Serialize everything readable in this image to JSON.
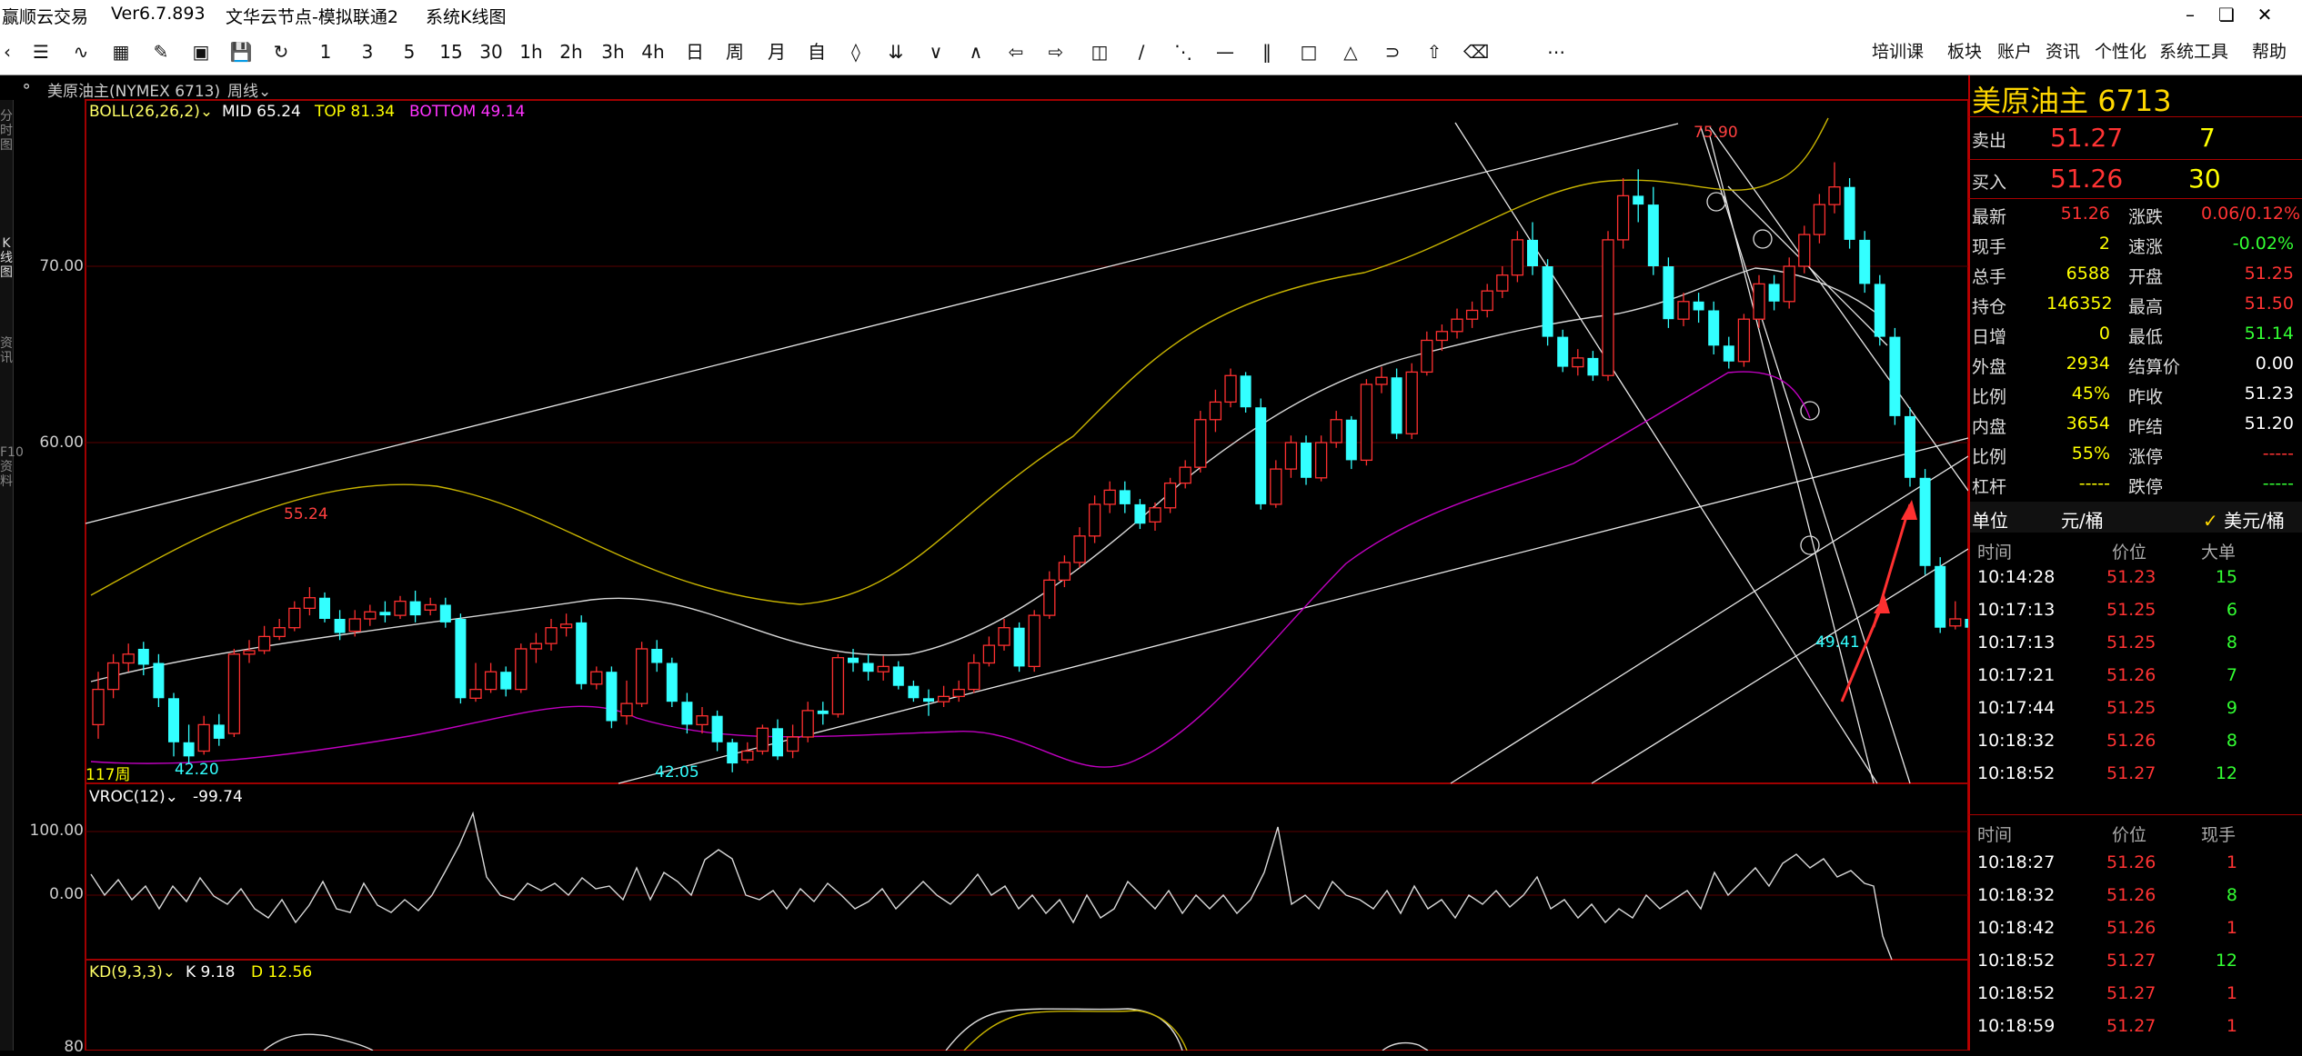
{
  "app": {
    "name": "赢顺云交易",
    "version": "Ver6.7.893",
    "node": "文华云节点-模拟联通2",
    "mode": "系统K线图"
  },
  "toolbar": {
    "periods": [
      "1",
      "3",
      "5",
      "15",
      "30",
      "1h",
      "2h",
      "3h",
      "4h",
      "日",
      "周",
      "月",
      "自"
    ],
    "menus": [
      "培训课",
      "板块",
      "账户",
      "资讯",
      "个性化",
      "系统工具",
      "帮助"
    ]
  },
  "chart_header": {
    "instrument": "美原油主(NYMEX 6713)",
    "period": "周线"
  },
  "main_panel": {
    "indicator": "BOLL(26,26,2)",
    "mid": "MID 65.24",
    "top": "TOP 81.34",
    "bottom": "BOTTOM 49.14",
    "axis_70": "70.00",
    "axis_60": "60.00",
    "ann_high": "75.90",
    "ann_5524": "55.24",
    "ann_4220": "42.20",
    "ann_4205": "42.05",
    "ann_4941": "49.41",
    "count": "117周"
  },
  "vroc_panel": {
    "indicator": "VROC(12)",
    "value": "-99.74",
    "axis_100": "100.00",
    "axis_0": "0.00"
  },
  "kd_panel": {
    "indicator": "KD(9,3,3)",
    "k": "K 9.18",
    "d": "D 12.56",
    "axis_80": "80"
  },
  "left_tabs": [
    "分时图",
    "K线图",
    "资讯",
    "F10资料"
  ],
  "quote": {
    "title": "美原油主",
    "code": "6713",
    "ask_label": "卖出",
    "ask_price": "51.27",
    "ask_vol": "7",
    "bid_label": "买入",
    "bid_price": "51.26",
    "bid_vol": "30",
    "stats": [
      {
        "l1": "最新",
        "v1": "51.26",
        "l2": "涨跌",
        "v2": "0.06/0.12%",
        "c1": "#ff3333",
        "c2": "#ff3333"
      },
      {
        "l1": "现手",
        "v1": "2",
        "l2": "速涨",
        "v2": "-0.02%",
        "c1": "#ffff00",
        "c2": "#33ff33"
      },
      {
        "l1": "总手",
        "v1": "6588",
        "l2": "开盘",
        "v2": "51.25",
        "c1": "#ffff00",
        "c2": "#ff3333"
      },
      {
        "l1": "持仓",
        "v1": "146352",
        "l2": "最高",
        "v2": "51.50",
        "c1": "#ffff00",
        "c2": "#ff3333"
      },
      {
        "l1": "日增",
        "v1": "0",
        "l2": "最低",
        "v2": "51.14",
        "c1": "#ffff00",
        "c2": "#33ff33"
      },
      {
        "l1": "外盘",
        "v1": "2934",
        "l2": "结算价",
        "v2": "0.00",
        "c1": "#ffff00",
        "c2": "#ffffff"
      },
      {
        "l1": "比例",
        "v1": "45%",
        "l2": "昨收",
        "v2": "51.23",
        "c1": "#ffff00",
        "c2": "#ffffff"
      },
      {
        "l1": "内盘",
        "v1": "3654",
        "l2": "昨结",
        "v2": "51.20",
        "c1": "#ffff00",
        "c2": "#ffffff"
      },
      {
        "l1": "比例",
        "v1": "55%",
        "l2": "涨停",
        "v2": "-----",
        "c1": "#ffff00",
        "c2": "#ff3333"
      },
      {
        "l1": "杠杆",
        "v1": "-----",
        "l2": "跌停",
        "v2": "-----",
        "c1": "#ffff00",
        "c2": "#33ff33"
      }
    ],
    "unit_label": "单位",
    "unit_value": "元/桶",
    "unit_check": "美元/桶",
    "big_header": [
      "时间",
      "价位",
      "大单"
    ],
    "big_trades": [
      [
        "10:14:28",
        "51.23",
        "15"
      ],
      [
        "10:17:13",
        "51.25",
        "6"
      ],
      [
        "10:17:13",
        "51.25",
        "8"
      ],
      [
        "10:17:21",
        "51.26",
        "7"
      ],
      [
        "10:17:44",
        "51.25",
        "9"
      ],
      [
        "10:18:32",
        "51.26",
        "8"
      ],
      [
        "10:18:52",
        "51.27",
        "12"
      ]
    ],
    "tick_header": [
      "时间",
      "价位",
      "现手"
    ],
    "ticks": [
      [
        "10:18:27",
        "51.26",
        "1"
      ],
      [
        "10:18:32",
        "51.26",
        "8"
      ],
      [
        "10:18:42",
        "51.26",
        "1"
      ],
      [
        "10:18:52",
        "51.27",
        "12"
      ],
      [
        "10:18:52",
        "51.27",
        "1"
      ],
      [
        "10:18:59",
        "51.27",
        "1"
      ]
    ]
  },
  "chart_data": {
    "type": "candlestick",
    "ylim": [
      40,
      77
    ],
    "candles": [
      [
        44,
        46,
        43.2,
        47
      ],
      [
        46,
        47.5,
        45.5,
        48
      ],
      [
        47.5,
        48,
        47,
        48.6
      ],
      [
        48.3,
        47.4,
        46.8,
        48.7
      ],
      [
        47.5,
        45.5,
        45,
        48
      ],
      [
        45.5,
        43,
        42.2,
        45.8
      ],
      [
        43,
        42.2,
        41.8,
        44
      ],
      [
        42.5,
        44,
        42.3,
        44.5
      ],
      [
        44,
        43.2,
        42.8,
        44.6
      ],
      [
        43.5,
        48,
        43.3,
        48.3
      ],
      [
        48,
        48.2,
        47.5,
        48.8
      ],
      [
        48.2,
        49,
        48,
        49.6
      ],
      [
        49,
        49.5,
        48.8,
        50
      ],
      [
        49.5,
        50.6,
        49.3,
        51
      ],
      [
        50.6,
        51.2,
        50.2,
        51.8
      ],
      [
        51.2,
        50,
        49.8,
        51.5
      ],
      [
        50,
        49.2,
        48.8,
        50.5
      ],
      [
        49.3,
        50,
        49,
        50.5
      ],
      [
        50,
        50.4,
        49.6,
        50.8
      ],
      [
        50.4,
        50.2,
        49.8,
        51
      ],
      [
        50.2,
        51,
        50,
        51.3
      ],
      [
        51,
        50.2,
        49.8,
        51.6
      ],
      [
        50.5,
        50.8,
        50.2,
        51.2
      ],
      [
        50.8,
        49.8,
        49.5,
        51.2
      ],
      [
        50,
        45.5,
        45.2,
        50.3
      ],
      [
        45.5,
        46,
        45.3,
        47.5
      ],
      [
        46,
        47,
        45.8,
        47.5
      ],
      [
        47,
        46,
        45.6,
        47.3
      ],
      [
        46,
        48.3,
        45.8,
        48.6
      ],
      [
        48.3,
        48.6,
        47.5,
        49.2
      ],
      [
        48.6,
        49.5,
        48.2,
        50
      ],
      [
        49.5,
        49.7,
        49,
        50.3
      ],
      [
        49.8,
        46.3,
        46,
        50.2
      ],
      [
        46.3,
        47,
        46,
        47.3
      ],
      [
        47,
        44.2,
        43.8,
        47.3
      ],
      [
        44.5,
        45.2,
        44,
        46.5
      ],
      [
        45.2,
        48.3,
        45,
        48.7
      ],
      [
        48.3,
        47.5,
        47,
        48.8
      ],
      [
        47.5,
        45.3,
        45,
        47.8
      ],
      [
        45.3,
        44,
        43.5,
        45.8
      ],
      [
        44,
        44.5,
        43.5,
        45
      ],
      [
        44.5,
        43,
        42.5,
        44.8
      ],
      [
        43,
        41.8,
        41.3,
        43.2
      ],
      [
        42,
        42.5,
        41.8,
        43
      ],
      [
        42.5,
        43.8,
        42.3,
        44
      ],
      [
        43.8,
        42.2,
        42,
        44.3
      ],
      [
        42.5,
        43.3,
        42.1,
        44
      ],
      [
        43.3,
        44.8,
        43,
        45.3
      ],
      [
        44.8,
        44.6,
        44,
        45.3
      ],
      [
        44.6,
        47.8,
        44.4,
        48
      ],
      [
        47.8,
        47.5,
        47,
        48.3
      ],
      [
        47.5,
        47,
        46.5,
        48
      ],
      [
        47,
        47.3,
        46.5,
        47.9
      ],
      [
        47.3,
        46.2,
        46,
        47.6
      ],
      [
        46.2,
        45.5,
        45.3,
        46.5
      ],
      [
        45.5,
        45.3,
        44.5,
        46
      ],
      [
        45.3,
        45.6,
        45,
        46.2
      ],
      [
        45.6,
        46,
        45.3,
        46.5
      ],
      [
        46,
        47.5,
        45.8,
        48
      ],
      [
        47.5,
        48.5,
        47.3,
        49
      ],
      [
        48.5,
        49.5,
        48.2,
        50
      ],
      [
        49.5,
        47.3,
        47,
        49.8
      ],
      [
        47.3,
        50.2,
        47,
        50.5
      ],
      [
        50.2,
        52.2,
        50,
        52.7
      ],
      [
        52.2,
        53.2,
        51.8,
        53.6
      ],
      [
        53.2,
        54.7,
        52.9,
        55.2
      ],
      [
        54.7,
        56.5,
        54.3,
        57
      ],
      [
        56.5,
        57.3,
        56,
        57.8
      ],
      [
        57.3,
        56.5,
        56,
        57.8
      ],
      [
        56.5,
        55.4,
        55.1,
        56.8
      ],
      [
        55.5,
        56.3,
        55,
        56.6
      ],
      [
        56.3,
        57.7,
        56,
        58
      ],
      [
        57.7,
        58.6,
        57.4,
        59
      ],
      [
        58.6,
        61.3,
        58.3,
        61.8
      ],
      [
        61.3,
        62.3,
        60.6,
        63
      ],
      [
        62.3,
        63.8,
        62,
        64.2
      ],
      [
        63.8,
        62,
        61.7,
        64
      ],
      [
        62,
        56.5,
        56.2,
        62.5
      ],
      [
        56.5,
        58.5,
        56.3,
        59
      ],
      [
        58.5,
        60,
        58,
        60.4
      ],
      [
        60,
        58,
        57.6,
        60.4
      ],
      [
        58,
        60,
        57.8,
        60.4
      ],
      [
        60,
        61.3,
        59.7,
        61.8
      ],
      [
        61.3,
        59,
        58.5,
        61.5
      ],
      [
        59,
        63.3,
        58.7,
        63.6
      ],
      [
        63.3,
        63.7,
        62.8,
        64.3
      ],
      [
        63.7,
        60.5,
        60.2,
        64.2
      ],
      [
        60.5,
        64,
        60.2,
        64.5
      ],
      [
        64,
        65.8,
        63.8,
        66.3
      ],
      [
        65.8,
        66.3,
        65.2,
        66.7
      ],
      [
        66.3,
        67,
        65.9,
        67.6
      ],
      [
        67,
        67.5,
        66.5,
        68
      ],
      [
        67.5,
        68.6,
        67.1,
        69
      ],
      [
        68.6,
        69.5,
        68.2,
        70
      ],
      [
        69.5,
        71.5,
        69.1,
        72
      ],
      [
        71.5,
        70,
        69.5,
        72.5
      ],
      [
        70,
        66,
        65.5,
        70.4
      ],
      [
        66,
        64.3,
        64,
        66.4
      ],
      [
        64.3,
        64.8,
        63.8,
        65.3
      ],
      [
        64.8,
        63.8,
        63.5,
        65.2
      ],
      [
        63.8,
        71.5,
        63.5,
        72
      ],
      [
        71.5,
        74,
        71,
        75
      ],
      [
        74,
        73.5,
        72.5,
        75.5
      ],
      [
        73.5,
        70,
        69.5,
        74.5
      ],
      [
        70,
        67,
        66.5,
        70.5
      ],
      [
        67,
        68,
        66.6,
        68.5
      ],
      [
        68,
        67.5,
        66.8,
        68.5
      ],
      [
        67.5,
        65.5,
        65,
        68
      ],
      [
        65.5,
        64.6,
        64.2,
        66
      ],
      [
        64.6,
        67,
        64.3,
        67.3
      ],
      [
        67,
        69,
        66.5,
        69.5
      ],
      [
        69,
        68,
        67.5,
        69.5
      ],
      [
        68,
        70,
        67.6,
        70.5
      ],
      [
        70,
        71.8,
        69.6,
        72.3
      ],
      [
        71.8,
        73.5,
        71.3,
        74.1
      ],
      [
        73.5,
        74.5,
        73,
        75.9
      ],
      [
        74.5,
        71.5,
        71,
        75
      ],
      [
        71.5,
        69,
        68.5,
        72
      ],
      [
        69,
        66,
        65.5,
        69.5
      ],
      [
        66,
        61.5,
        61,
        66.5
      ],
      [
        61.5,
        58,
        57.5,
        62
      ],
      [
        58,
        53,
        52.5,
        58.5
      ],
      [
        53,
        49.5,
        49.2,
        53.5
      ],
      [
        49.6,
        50,
        49.4,
        51
      ],
      [
        50,
        49.5,
        49.2,
        50.6
      ],
      [
        49.5,
        49,
        48.8,
        50.2
      ]
    ]
  }
}
